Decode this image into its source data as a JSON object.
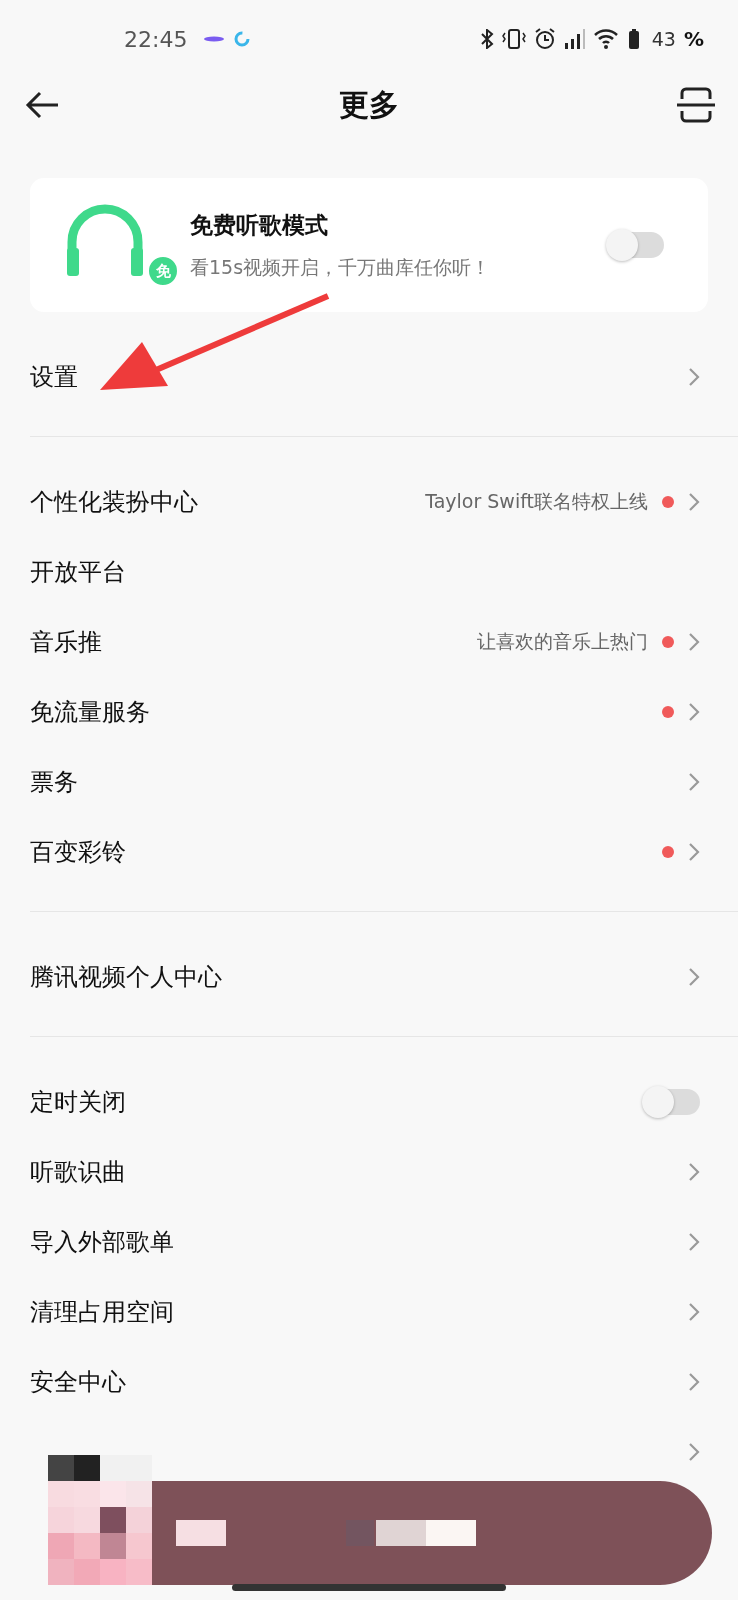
{
  "status_bar": {
    "time": "22:45",
    "battery": "43",
    "battery_unit": "%"
  },
  "header": {
    "title": "更多"
  },
  "promo": {
    "title": "免费听歌模式",
    "subtitle": "看15s视频开启，千万曲库任你听！",
    "badge": "免",
    "on": false
  },
  "sections": [
    [
      {
        "kind": "link",
        "label": "设置",
        "dot": false
      }
    ],
    [
      {
        "kind": "link",
        "label": "个性化装扮中心",
        "hint": "Taylor Swift联名特权上线",
        "dot": true
      },
      {
        "kind": "plain",
        "label": "开放平台",
        "dot": false
      },
      {
        "kind": "link",
        "label": "音乐推",
        "hint": "让喜欢的音乐上热门",
        "dot": true
      },
      {
        "kind": "link",
        "label": "免流量服务",
        "dot": true
      },
      {
        "kind": "link",
        "label": "票务",
        "dot": false
      },
      {
        "kind": "link",
        "label": "百变彩铃",
        "dot": true
      }
    ],
    [
      {
        "kind": "link",
        "label": "腾讯视频个人中心",
        "dot": false
      }
    ],
    [
      {
        "kind": "toggle",
        "label": "定时关闭",
        "on": false,
        "dot": false
      },
      {
        "kind": "link",
        "label": "听歌识曲",
        "dot": false
      },
      {
        "kind": "link",
        "label": "导入外部歌单",
        "dot": false
      },
      {
        "kind": "link",
        "label": "清理占用空间",
        "dot": false
      },
      {
        "kind": "link",
        "label": "安全中心",
        "dot": false
      },
      {
        "kind": "link",
        "dot": false
      }
    ]
  ]
}
